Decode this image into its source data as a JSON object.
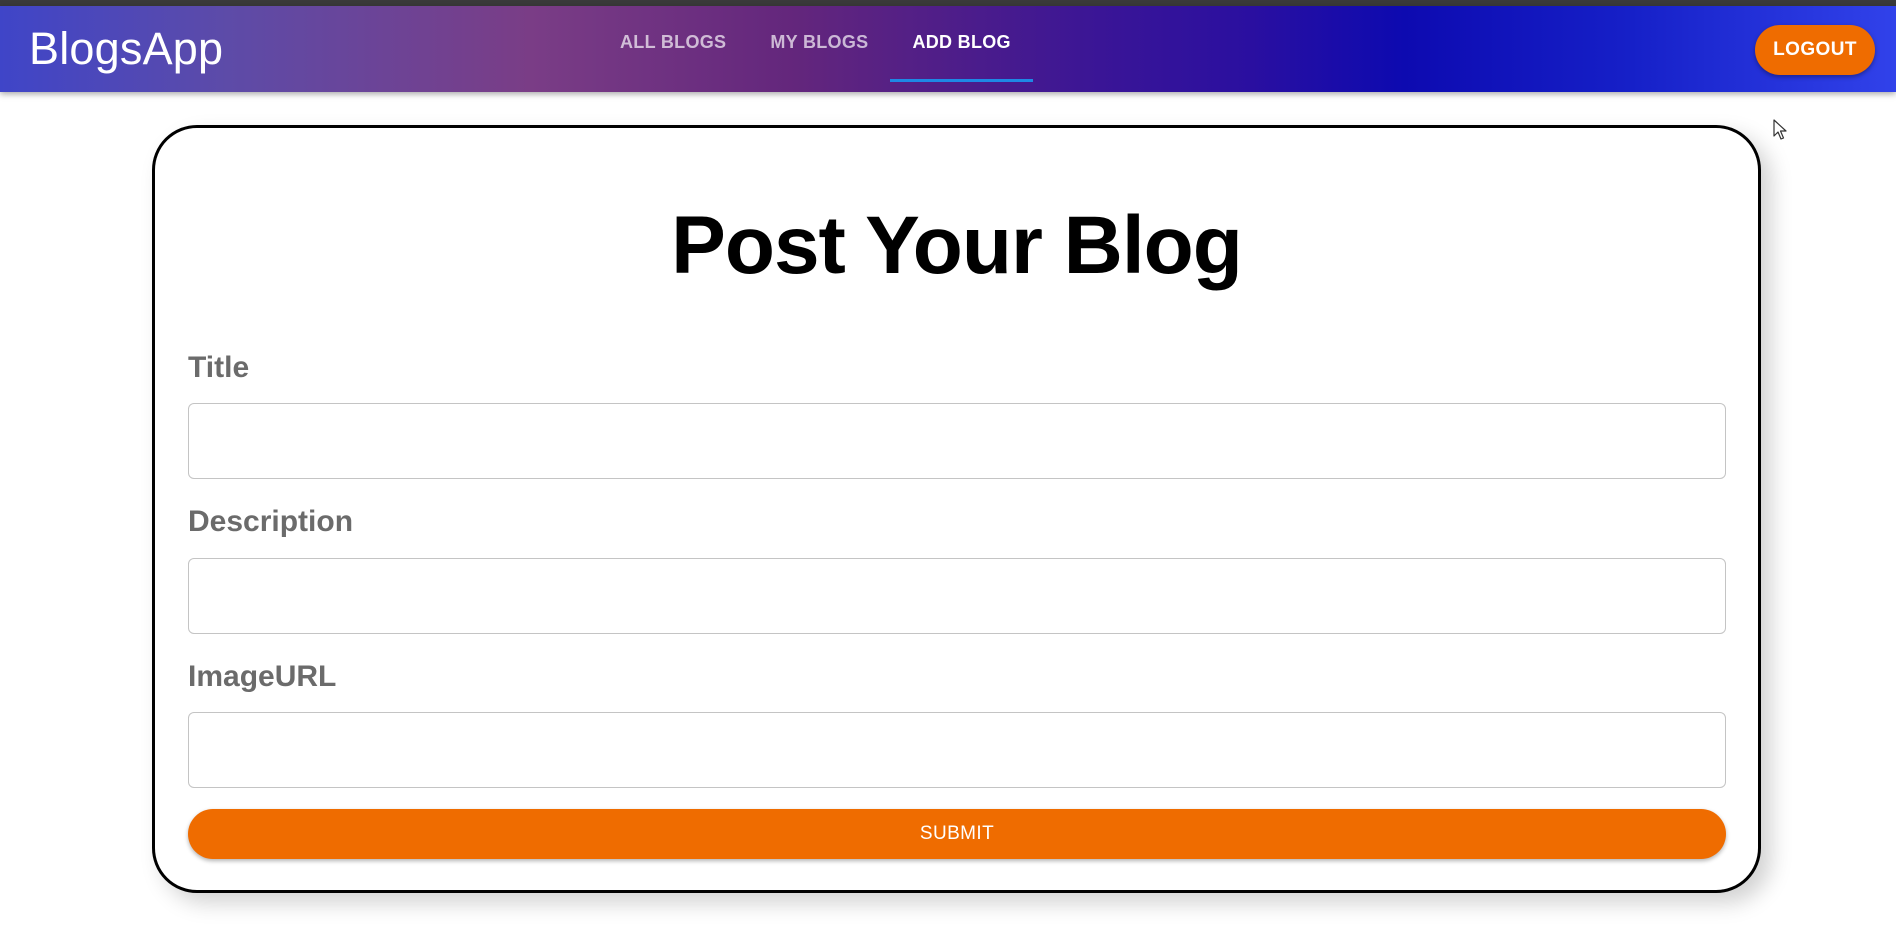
{
  "app": {
    "brand": "BlogsApp"
  },
  "nav": {
    "tabs": [
      {
        "label": "ALL BLOGS",
        "active": false
      },
      {
        "label": "MY BLOGS",
        "active": false
      },
      {
        "label": "ADD BLOG",
        "active": true
      }
    ],
    "logout_label": "LOGOUT"
  },
  "form": {
    "heading": "Post Your Blog",
    "fields": [
      {
        "label": "Title",
        "value": "",
        "placeholder": ""
      },
      {
        "label": "Description",
        "value": "",
        "placeholder": ""
      },
      {
        "label": "ImageURL",
        "value": "",
        "placeholder": ""
      }
    ],
    "submit_label": "SUBMIT"
  },
  "colors": {
    "accent": "#ef6c00",
    "tab_indicator": "#1e88e5",
    "appbar_start": "#3f45c8",
    "appbar_end": "#3142ea"
  },
  "icons": {
    "pointer": "mouse-cursor-icon"
  }
}
